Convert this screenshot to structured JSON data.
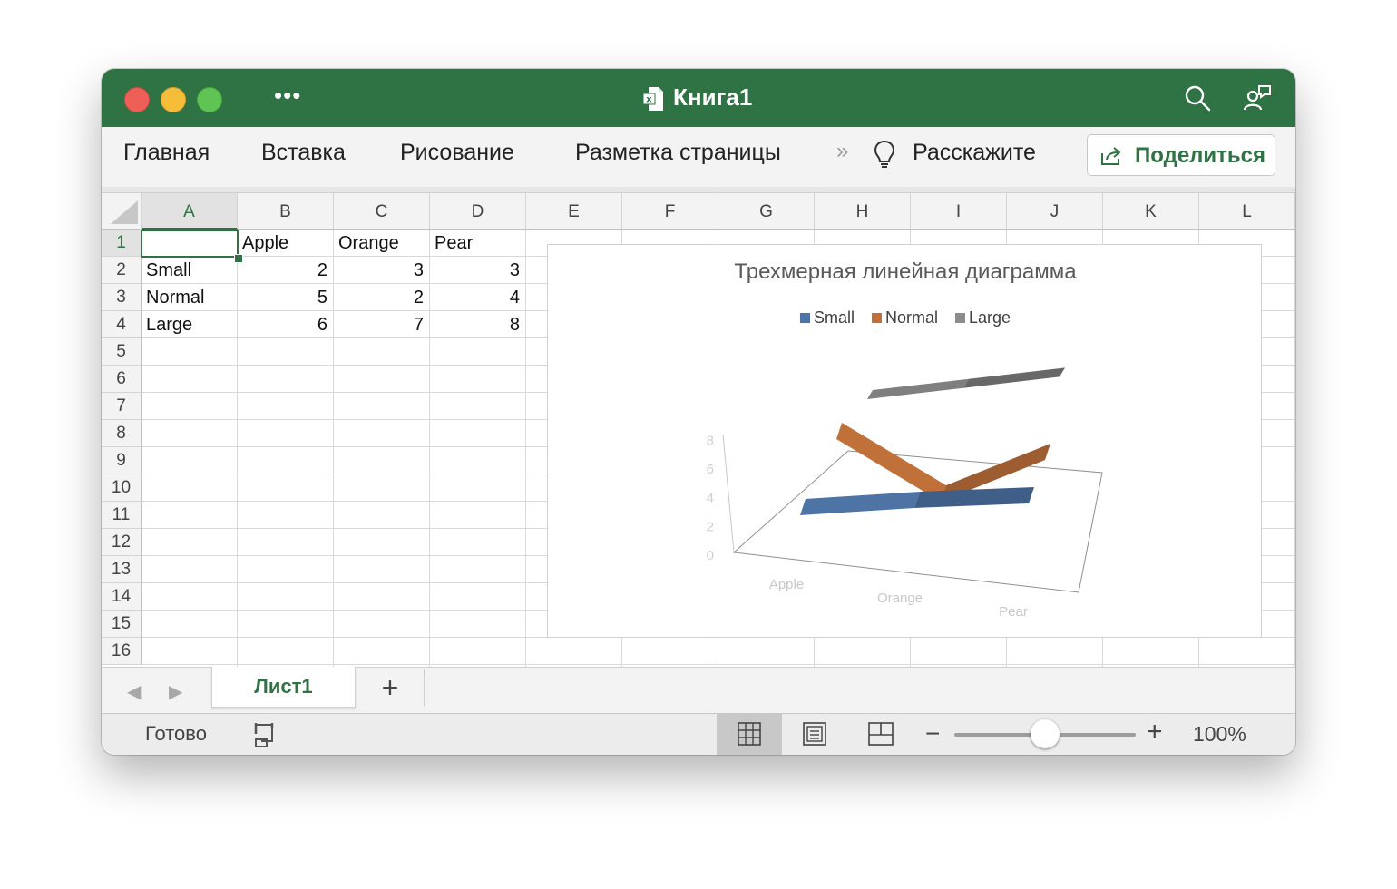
{
  "window": {
    "title": "Книга1"
  },
  "ribbon": {
    "tabs": [
      "Главная",
      "Вставка",
      "Рисование",
      "Разметка страницы"
    ],
    "more": "»",
    "tell_me": "Расскажите",
    "share": "Поделиться"
  },
  "sheet": {
    "columns": [
      "A",
      "B",
      "C",
      "D",
      "E",
      "F",
      "G",
      "H",
      "I",
      "J",
      "K",
      "L"
    ],
    "rows": [
      "1",
      "2",
      "3",
      "4",
      "5",
      "6",
      "7",
      "8",
      "9",
      "10",
      "11",
      "12",
      "13",
      "14",
      "15",
      "16"
    ],
    "selected_cell": "A1",
    "cells": {
      "B1": "Apple",
      "C1": "Orange",
      "D1": "Pear",
      "A2": "Small",
      "B2": "2",
      "C2": "3",
      "D2": "3",
      "A3": "Normal",
      "B3": "5",
      "C3": "2",
      "D3": "4",
      "A4": "Large",
      "B4": "6",
      "C4": "7",
      "D4": "8"
    }
  },
  "chart_data": {
    "type": "line",
    "title": "Трехмерная линейная диаграмма",
    "categories": [
      "Apple",
      "Orange",
      "Pear"
    ],
    "series": [
      {
        "name": "Small",
        "values": [
          2,
          3,
          3
        ],
        "color": "#4e74a6"
      },
      {
        "name": "Normal",
        "values": [
          5,
          2,
          4
        ],
        "color": "#c0713a"
      },
      {
        "name": "Large",
        "values": [
          6,
          7,
          8
        ],
        "color": "#7f7f7f"
      }
    ],
    "y_ticks": [
      "0",
      "2",
      "4",
      "6",
      "8"
    ],
    "ylim": [
      0,
      8
    ],
    "legend": "top",
    "style": "3d"
  },
  "sheet_tabs": {
    "active": "Лист1",
    "add": "+"
  },
  "status": {
    "ready": "Готово",
    "zoom_minus": "−",
    "zoom_plus": "+",
    "zoom": "100%"
  },
  "colors": {
    "accent": "#2f7243",
    "grid": "#d9d9d9"
  }
}
